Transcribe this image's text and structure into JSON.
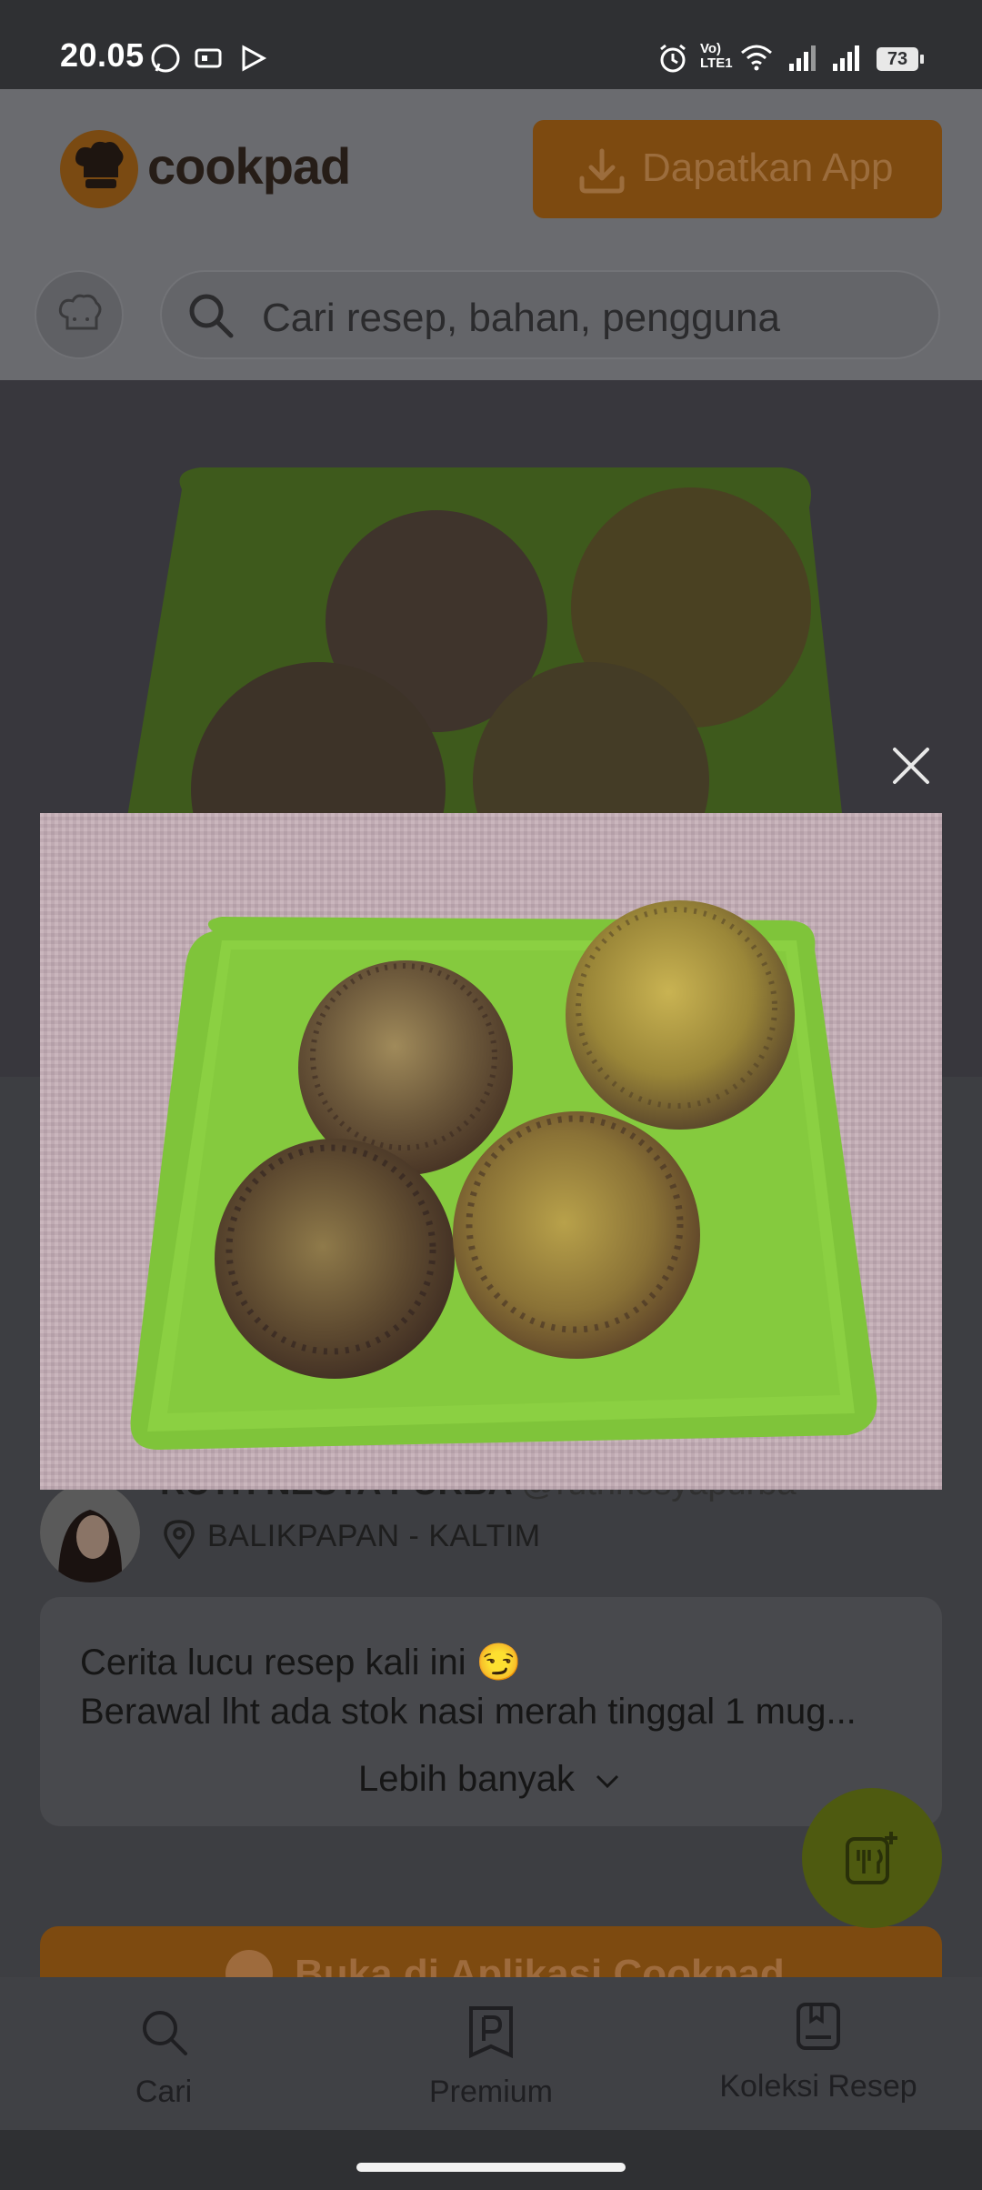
{
  "status_bar": {
    "time": "20.05",
    "battery": "73",
    "net_label": "Vo) LTE1"
  },
  "header": {
    "logo_text": "cookpad",
    "get_app_label": "Dapatkan App"
  },
  "search": {
    "placeholder": "Cari resep, bahan, pengguna"
  },
  "author": {
    "name": "RUTH NESYA PURBA",
    "handle": "@ruthnesyapurba",
    "location": "BALIKPAPAN - KALTIM"
  },
  "story": {
    "line1": "Cerita lucu resep kali ini 😏",
    "line2": "Berawal lht ada stok nasi merah tinggal 1 mug...",
    "more_label": "Lebih banyak"
  },
  "open_app_label": "Buka di Aplikasi Cookpad",
  "bottom_nav": {
    "items": [
      {
        "label": "Cari",
        "icon": "search-icon"
      },
      {
        "label": "Premium",
        "icon": "premium-icon"
      },
      {
        "label": "Koleksi Resep",
        "icon": "collection-icon"
      }
    ]
  },
  "colors": {
    "brand_orange": "#f7941d",
    "fab_green": "#8cb31c",
    "plate_green": "#8ed13a"
  }
}
